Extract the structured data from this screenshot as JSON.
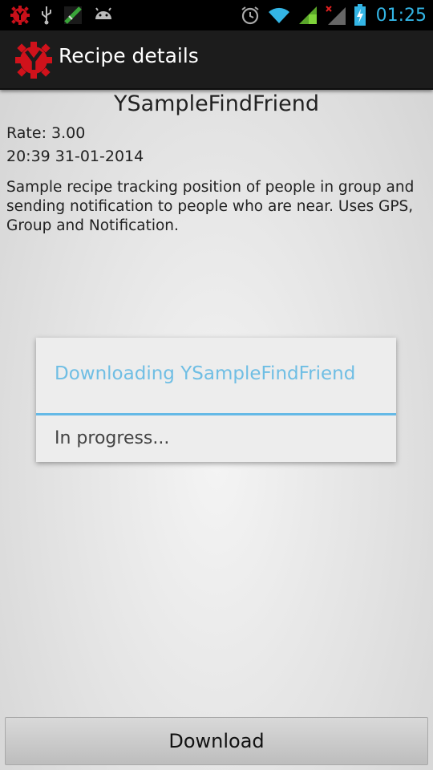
{
  "status_bar": {
    "time": "01:25",
    "left_icons": [
      "app-notification-icon",
      "usb-icon",
      "debug-icon",
      "android-icon"
    ],
    "right_icons": [
      "alarm-icon",
      "wifi-icon",
      "signal-icon",
      "no-signal-icon",
      "battery-charging-icon"
    ]
  },
  "action_bar": {
    "title": "Recipe details"
  },
  "recipe": {
    "name": "YSampleFindFriend",
    "rate": "Rate: 3.00",
    "date": "20:39 31-01-2014",
    "description": "Sample recipe tracking position of people in group and sending notification to people who are near. Uses GPS, Group and Notification."
  },
  "dialog": {
    "title": "Downloading YSampleFindFriend",
    "message": "In progress..."
  },
  "buttons": {
    "download_label": "Download"
  },
  "colors": {
    "accent": "#33b5e5",
    "dialog_title": "#6fbee4",
    "logo_red": "#d0121b"
  }
}
